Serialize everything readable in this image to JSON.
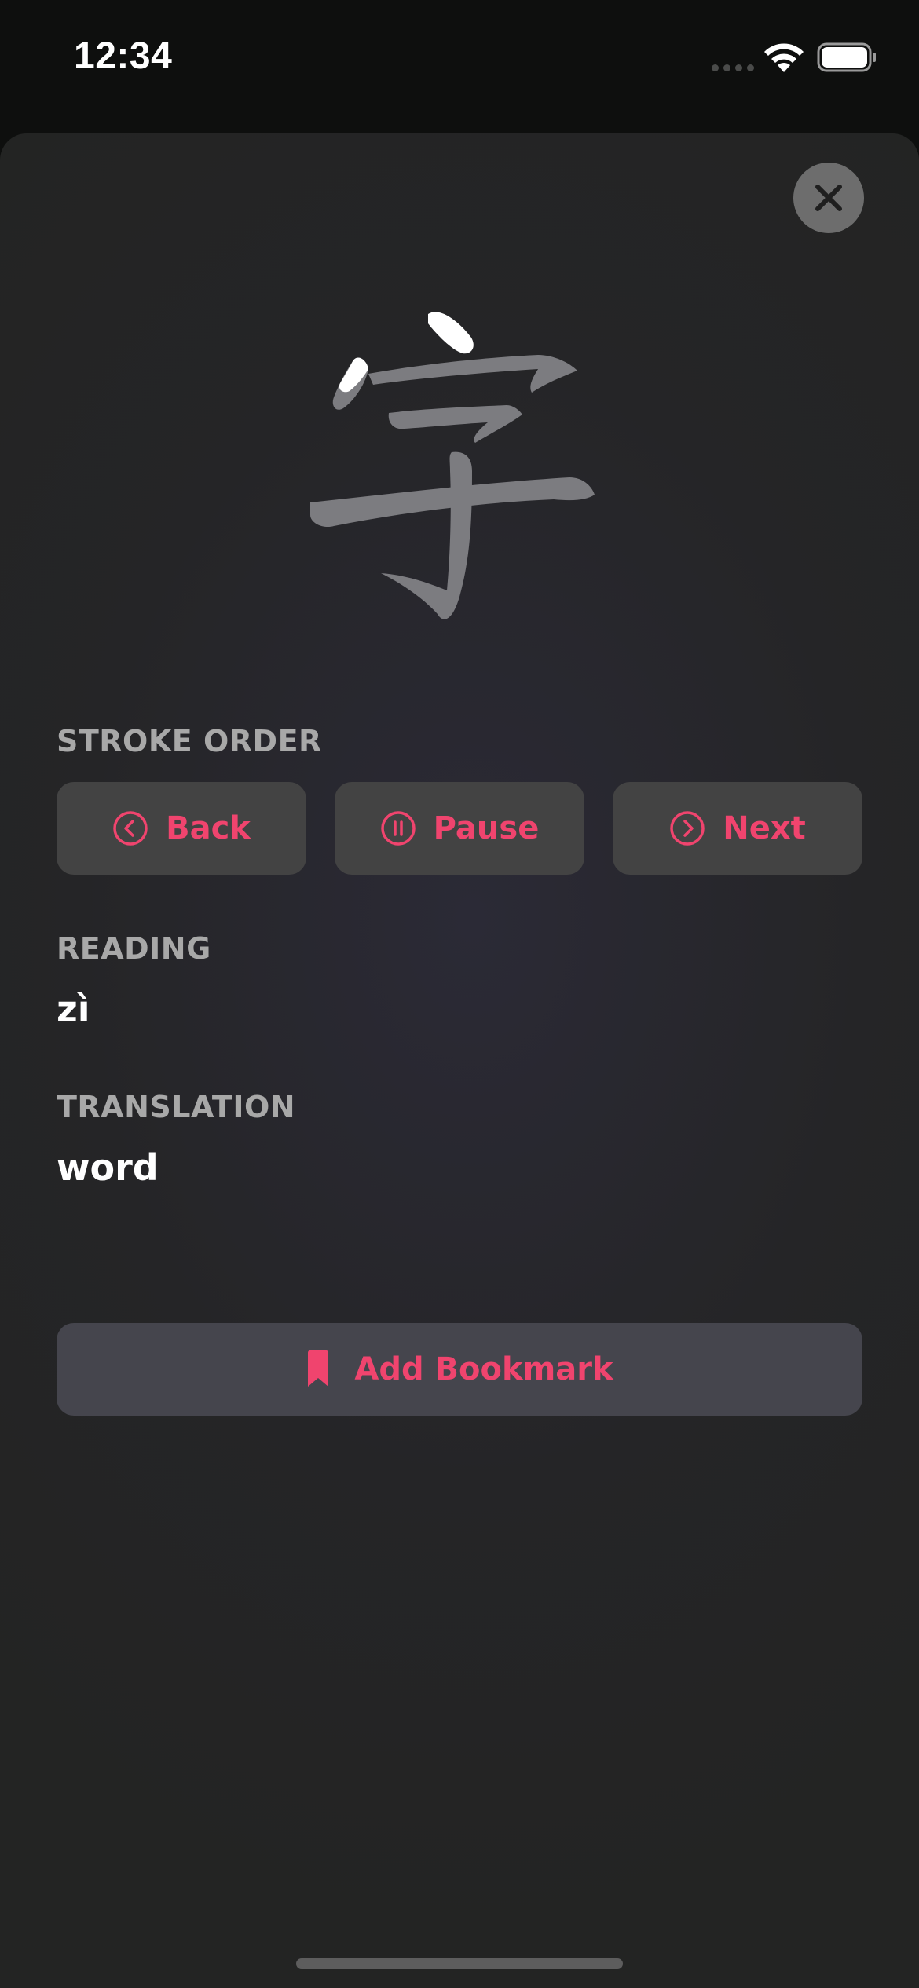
{
  "status_bar": {
    "time": "12:34"
  },
  "character": {
    "glyph": "字",
    "highlight_color": "#ffffff",
    "stroke_color": "#7c7c80"
  },
  "stroke_order": {
    "label": "STROKE ORDER",
    "buttons": [
      {
        "label": "Back",
        "icon": "chevron-left-circle-icon"
      },
      {
        "label": "Pause",
        "icon": "pause-circle-icon"
      },
      {
        "label": "Next",
        "icon": "chevron-right-circle-icon"
      }
    ]
  },
  "reading": {
    "label": "READING",
    "value": "zì"
  },
  "translation": {
    "label": "TRANSLATION",
    "value": "word"
  },
  "bookmark": {
    "label": "Add Bookmark",
    "icon": "bookmark-icon"
  },
  "colors": {
    "accent": "#f0446e",
    "button_bg": "#434343",
    "label": "#a8a8a8"
  }
}
